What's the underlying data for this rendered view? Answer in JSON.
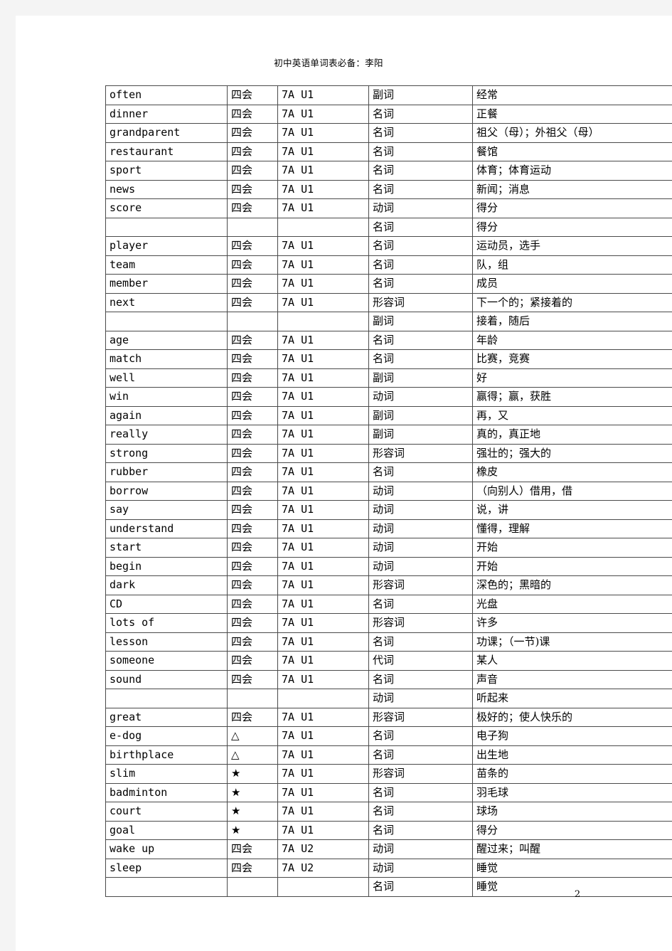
{
  "document": {
    "title": "初中英语单词表必备：李阳",
    "page_number": "2"
  },
  "table": {
    "rows": [
      {
        "word": "often",
        "mark": "四会",
        "unit": "7A U1",
        "pos": "副词",
        "def": "经常"
      },
      {
        "word": "dinner",
        "mark": "四会",
        "unit": "7A U1",
        "pos": "名词",
        "def": "正餐"
      },
      {
        "word": "grandparent",
        "mark": "四会",
        "unit": "7A U1",
        "pos": "名词",
        "def": "祖父（母）；外祖父（母）"
      },
      {
        "word": "restaurant",
        "mark": "四会",
        "unit": "7A U1",
        "pos": "名词",
        "def": "餐馆"
      },
      {
        "word": "sport",
        "mark": "四会",
        "unit": "7A U1",
        "pos": "名词",
        "def": "体育；体育运动"
      },
      {
        "word": "news",
        "mark": "四会",
        "unit": "7A U1",
        "pos": "名词",
        "def": "新闻；消息"
      },
      {
        "word": "score",
        "mark": "四会",
        "unit": "7A U1",
        "pos": "动词",
        "def": "得分"
      },
      {
        "word": "",
        "mark": "",
        "unit": "",
        "pos": "名词",
        "def": "得分"
      },
      {
        "word": "player",
        "mark": "四会",
        "unit": "7A U1",
        "pos": "名词",
        "def": "运动员，选手"
      },
      {
        "word": "team",
        "mark": "四会",
        "unit": "7A U1",
        "pos": "名词",
        "def": "队，组"
      },
      {
        "word": "member",
        "mark": "四会",
        "unit": "7A U1",
        "pos": "名词",
        "def": "成员"
      },
      {
        "word": "next",
        "mark": "四会",
        "unit": "7A U1",
        "pos": "形容词",
        "def": "下一个的；紧接着的"
      },
      {
        "word": "",
        "mark": "",
        "unit": "",
        "pos": "副词",
        "def": "接着，随后"
      },
      {
        "word": "age",
        "mark": "四会",
        "unit": "7A U1",
        "pos": "名词",
        "def": "年龄"
      },
      {
        "word": "match",
        "mark": "四会",
        "unit": "7A U1",
        "pos": "名词",
        "def": "比赛，竞赛"
      },
      {
        "word": "well",
        "mark": "四会",
        "unit": "7A U1",
        "pos": "副词",
        "def": "好"
      },
      {
        "word": "win",
        "mark": "四会",
        "unit": "7A U1",
        "pos": "动词",
        "def": "赢得；赢，获胜"
      },
      {
        "word": "again",
        "mark": "四会",
        "unit": "7A U1",
        "pos": "副词",
        "def": "再，又"
      },
      {
        "word": "really",
        "mark": "四会",
        "unit": "7A U1",
        "pos": "副词",
        "def": "真的，真正地"
      },
      {
        "word": "strong",
        "mark": "四会",
        "unit": "7A U1",
        "pos": "形容词",
        "def": "强壮的；强大的"
      },
      {
        "word": "rubber",
        "mark": "四会",
        "unit": "7A U1",
        "pos": "名词",
        "def": "橡皮"
      },
      {
        "word": "borrow",
        "mark": "四会",
        "unit": "7A U1",
        "pos": "动词",
        "def": "（向别人）借用，借"
      },
      {
        "word": "say",
        "mark": "四会",
        "unit": "7A U1",
        "pos": "动词",
        "def": "说，讲"
      },
      {
        "word": "understand",
        "mark": "四会",
        "unit": "7A U1",
        "pos": "动词",
        "def": "懂得，理解"
      },
      {
        "word": "start",
        "mark": "四会",
        "unit": "7A U1",
        "pos": "动词",
        "def": "开始"
      },
      {
        "word": "begin",
        "mark": "四会",
        "unit": "7A U1",
        "pos": "动词",
        "def": "开始"
      },
      {
        "word": "dark",
        "mark": "四会",
        "unit": "7A U1",
        "pos": "形容词",
        "def": "深色的；黑暗的"
      },
      {
        "word": "CD",
        "mark": "四会",
        "unit": "7A U1",
        "pos": "名词",
        "def": "光盘"
      },
      {
        "word": "lots of",
        "mark": "四会",
        "unit": "7A U1",
        "pos": "形容词",
        "def": "许多"
      },
      {
        "word": "lesson",
        "mark": "四会",
        "unit": "7A U1",
        "pos": "名词",
        "def": "功课；（一节)课"
      },
      {
        "word": "someone",
        "mark": "四会",
        "unit": "7A U1",
        "pos": "代词",
        "def": "某人"
      },
      {
        "word": "sound",
        "mark": "四会",
        "unit": "7A U1",
        "pos": "名词",
        "def": "声音"
      },
      {
        "word": "",
        "mark": "",
        "unit": "",
        "pos": "动词",
        "def": "听起来"
      },
      {
        "word": "great",
        "mark": "四会",
        "unit": "7A U1",
        "pos": "形容词",
        "def": "极好的；使人快乐的"
      },
      {
        "word": "e-dog",
        "mark": "△",
        "unit": "7A U1",
        "pos": "名词",
        "def": "电子狗"
      },
      {
        "word": "birthplace",
        "mark": "△",
        "unit": "7A U1",
        "pos": "名词",
        "def": "出生地"
      },
      {
        "word": "slim",
        "mark": "★",
        "unit": "7A U1",
        "pos": "形容词",
        "def": "苗条的"
      },
      {
        "word": "badminton",
        "mark": "★",
        "unit": "7A U1",
        "pos": "名词",
        "def": "羽毛球"
      },
      {
        "word": "court",
        "mark": "★",
        "unit": "7A U1",
        "pos": "名词",
        "def": "球场"
      },
      {
        "word": "goal",
        "mark": "★",
        "unit": "7A U1",
        "pos": "名词",
        "def": "得分"
      },
      {
        "word": "wake up",
        "mark": "四会",
        "unit": "7A U2",
        "pos": "动词",
        "def": "醒过来；叫醒"
      },
      {
        "word": "sleep",
        "mark": "四会",
        "unit": "7A U2",
        "pos": "动词",
        "def": "睡觉"
      },
      {
        "word": "",
        "mark": "",
        "unit": "",
        "pos": "名词",
        "def": "睡觉"
      }
    ]
  }
}
